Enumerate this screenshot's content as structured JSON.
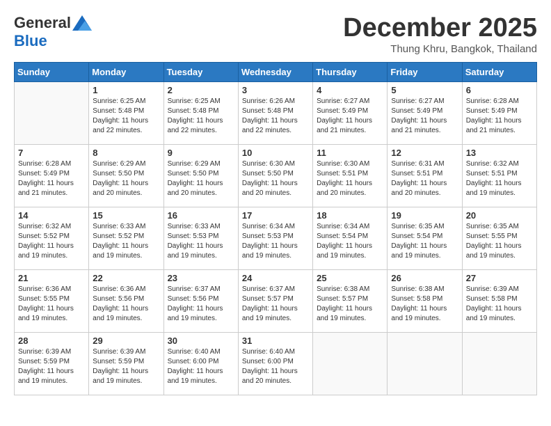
{
  "header": {
    "logo_general": "General",
    "logo_blue": "Blue",
    "month_title": "December 2025",
    "location": "Thung Khru, Bangkok, Thailand"
  },
  "days_of_week": [
    "Sunday",
    "Monday",
    "Tuesday",
    "Wednesday",
    "Thursday",
    "Friday",
    "Saturday"
  ],
  "weeks": [
    [
      {
        "day": "",
        "sunrise": "",
        "sunset": "",
        "daylight": ""
      },
      {
        "day": "1",
        "sunrise": "Sunrise: 6:25 AM",
        "sunset": "Sunset: 5:48 PM",
        "daylight": "Daylight: 11 hours and 22 minutes."
      },
      {
        "day": "2",
        "sunrise": "Sunrise: 6:25 AM",
        "sunset": "Sunset: 5:48 PM",
        "daylight": "Daylight: 11 hours and 22 minutes."
      },
      {
        "day": "3",
        "sunrise": "Sunrise: 6:26 AM",
        "sunset": "Sunset: 5:48 PM",
        "daylight": "Daylight: 11 hours and 22 minutes."
      },
      {
        "day": "4",
        "sunrise": "Sunrise: 6:27 AM",
        "sunset": "Sunset: 5:49 PM",
        "daylight": "Daylight: 11 hours and 21 minutes."
      },
      {
        "day": "5",
        "sunrise": "Sunrise: 6:27 AM",
        "sunset": "Sunset: 5:49 PM",
        "daylight": "Daylight: 11 hours and 21 minutes."
      },
      {
        "day": "6",
        "sunrise": "Sunrise: 6:28 AM",
        "sunset": "Sunset: 5:49 PM",
        "daylight": "Daylight: 11 hours and 21 minutes."
      }
    ],
    [
      {
        "day": "7",
        "sunrise": "Sunrise: 6:28 AM",
        "sunset": "Sunset: 5:49 PM",
        "daylight": "Daylight: 11 hours and 21 minutes."
      },
      {
        "day": "8",
        "sunrise": "Sunrise: 6:29 AM",
        "sunset": "Sunset: 5:50 PM",
        "daylight": "Daylight: 11 hours and 20 minutes."
      },
      {
        "day": "9",
        "sunrise": "Sunrise: 6:29 AM",
        "sunset": "Sunset: 5:50 PM",
        "daylight": "Daylight: 11 hours and 20 minutes."
      },
      {
        "day": "10",
        "sunrise": "Sunrise: 6:30 AM",
        "sunset": "Sunset: 5:50 PM",
        "daylight": "Daylight: 11 hours and 20 minutes."
      },
      {
        "day": "11",
        "sunrise": "Sunrise: 6:30 AM",
        "sunset": "Sunset: 5:51 PM",
        "daylight": "Daylight: 11 hours and 20 minutes."
      },
      {
        "day": "12",
        "sunrise": "Sunrise: 6:31 AM",
        "sunset": "Sunset: 5:51 PM",
        "daylight": "Daylight: 11 hours and 20 minutes."
      },
      {
        "day": "13",
        "sunrise": "Sunrise: 6:32 AM",
        "sunset": "Sunset: 5:51 PM",
        "daylight": "Daylight: 11 hours and 19 minutes."
      }
    ],
    [
      {
        "day": "14",
        "sunrise": "Sunrise: 6:32 AM",
        "sunset": "Sunset: 5:52 PM",
        "daylight": "Daylight: 11 hours and 19 minutes."
      },
      {
        "day": "15",
        "sunrise": "Sunrise: 6:33 AM",
        "sunset": "Sunset: 5:52 PM",
        "daylight": "Daylight: 11 hours and 19 minutes."
      },
      {
        "day": "16",
        "sunrise": "Sunrise: 6:33 AM",
        "sunset": "Sunset: 5:53 PM",
        "daylight": "Daylight: 11 hours and 19 minutes."
      },
      {
        "day": "17",
        "sunrise": "Sunrise: 6:34 AM",
        "sunset": "Sunset: 5:53 PM",
        "daylight": "Daylight: 11 hours and 19 minutes."
      },
      {
        "day": "18",
        "sunrise": "Sunrise: 6:34 AM",
        "sunset": "Sunset: 5:54 PM",
        "daylight": "Daylight: 11 hours and 19 minutes."
      },
      {
        "day": "19",
        "sunrise": "Sunrise: 6:35 AM",
        "sunset": "Sunset: 5:54 PM",
        "daylight": "Daylight: 11 hours and 19 minutes."
      },
      {
        "day": "20",
        "sunrise": "Sunrise: 6:35 AM",
        "sunset": "Sunset: 5:55 PM",
        "daylight": "Daylight: 11 hours and 19 minutes."
      }
    ],
    [
      {
        "day": "21",
        "sunrise": "Sunrise: 6:36 AM",
        "sunset": "Sunset: 5:55 PM",
        "daylight": "Daylight: 11 hours and 19 minutes."
      },
      {
        "day": "22",
        "sunrise": "Sunrise: 6:36 AM",
        "sunset": "Sunset: 5:56 PM",
        "daylight": "Daylight: 11 hours and 19 minutes."
      },
      {
        "day": "23",
        "sunrise": "Sunrise: 6:37 AM",
        "sunset": "Sunset: 5:56 PM",
        "daylight": "Daylight: 11 hours and 19 minutes."
      },
      {
        "day": "24",
        "sunrise": "Sunrise: 6:37 AM",
        "sunset": "Sunset: 5:57 PM",
        "daylight": "Daylight: 11 hours and 19 minutes."
      },
      {
        "day": "25",
        "sunrise": "Sunrise: 6:38 AM",
        "sunset": "Sunset: 5:57 PM",
        "daylight": "Daylight: 11 hours and 19 minutes."
      },
      {
        "day": "26",
        "sunrise": "Sunrise: 6:38 AM",
        "sunset": "Sunset: 5:58 PM",
        "daylight": "Daylight: 11 hours and 19 minutes."
      },
      {
        "day": "27",
        "sunrise": "Sunrise: 6:39 AM",
        "sunset": "Sunset: 5:58 PM",
        "daylight": "Daylight: 11 hours and 19 minutes."
      }
    ],
    [
      {
        "day": "28",
        "sunrise": "Sunrise: 6:39 AM",
        "sunset": "Sunset: 5:59 PM",
        "daylight": "Daylight: 11 hours and 19 minutes."
      },
      {
        "day": "29",
        "sunrise": "Sunrise: 6:39 AM",
        "sunset": "Sunset: 5:59 PM",
        "daylight": "Daylight: 11 hours and 19 minutes."
      },
      {
        "day": "30",
        "sunrise": "Sunrise: 6:40 AM",
        "sunset": "Sunset: 6:00 PM",
        "daylight": "Daylight: 11 hours and 19 minutes."
      },
      {
        "day": "31",
        "sunrise": "Sunrise: 6:40 AM",
        "sunset": "Sunset: 6:00 PM",
        "daylight": "Daylight: 11 hours and 20 minutes."
      },
      {
        "day": "",
        "sunrise": "",
        "sunset": "",
        "daylight": ""
      },
      {
        "day": "",
        "sunrise": "",
        "sunset": "",
        "daylight": ""
      },
      {
        "day": "",
        "sunrise": "",
        "sunset": "",
        "daylight": ""
      }
    ]
  ]
}
